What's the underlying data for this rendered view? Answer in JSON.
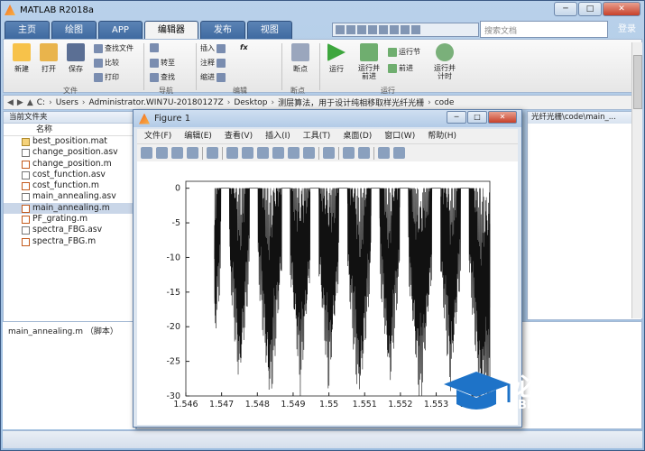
{
  "app": {
    "title": "MATLAB R2018a",
    "search_placeholder": "搜索文档",
    "login": "登录"
  },
  "tabs": [
    "主页",
    "绘图",
    "APP",
    "编辑器",
    "发布",
    "视图"
  ],
  "ribbon": {
    "new": "新建",
    "open": "打开",
    "save": "保存",
    "find_files": "查找文件",
    "compare": "比较",
    "print": "打印",
    "goto": "转至",
    "find": "查找",
    "insert": "插入",
    "comment": "注释",
    "indent": "缩进",
    "fx": "fx",
    "breakpoint": "断点",
    "run": "运行",
    "run_advance": "运行并\n前进",
    "run_section": "运行节",
    "advance": "前进",
    "run_time": "运行并\n计时",
    "groups": {
      "file": "文件",
      "navigate": "导航",
      "edit": "编辑",
      "breakpoints": "断点",
      "run": "运行"
    }
  },
  "path": [
    "C:",
    "Users",
    "Administrator.WIN7U-20180127Z",
    "Desktop",
    "测层算法，用于设计纯相移取样光纤光栅",
    "code"
  ],
  "left_panel": {
    "header": "当前文件夹",
    "column": "名称",
    "files": [
      {
        "name": "best_position.mat",
        "type": "mat"
      },
      {
        "name": "change_position.asv",
        "type": "asv"
      },
      {
        "name": "change_position.m",
        "type": "m"
      },
      {
        "name": "cost_function.asv",
        "type": "asv"
      },
      {
        "name": "cost_function.m",
        "type": "m"
      },
      {
        "name": "main_annealing.asv",
        "type": "asv"
      },
      {
        "name": "main_annealing.m",
        "type": "m"
      },
      {
        "name": "PF_grating.m",
        "type": "m"
      },
      {
        "name": "spectra_FBG.asv",
        "type": "asv"
      },
      {
        "name": "spectra_FBG.m",
        "type": "m"
      }
    ],
    "selected": "main_annealing.m",
    "detail": "main_annealing.m （脚本）"
  },
  "right_panel": {
    "path": "光纤光栅\\code\\main_..."
  },
  "figure": {
    "title": "Figure 1",
    "menu": [
      "文件(F)",
      "编辑(E)",
      "查看(V)",
      "插入(I)",
      "工具(T)",
      "桌面(D)",
      "窗口(W)",
      "帮助(H)"
    ]
  },
  "chart_data": {
    "type": "line",
    "title": "",
    "xlabel": "",
    "ylabel": "",
    "xlim": [
      1.546,
      1.5545
    ],
    "ylim": [
      -30,
      1
    ],
    "xticks": [
      1.546,
      1.547,
      1.548,
      1.549,
      1.55,
      1.551,
      1.552,
      1.553,
      1.554
    ],
    "yticks": [
      0,
      -5,
      -10,
      -15,
      -20,
      -25,
      -30
    ],
    "series": [
      {
        "name": "",
        "peaks_x": [
          1.5471,
          1.5479,
          1.5488,
          1.5496,
          1.5504,
          1.5513,
          1.5521,
          1.553,
          1.5538
        ],
        "peak_value": 0,
        "floor_value": -30,
        "mid_level": -14
      }
    ],
    "grid": false
  },
  "watermark": {
    "text": "必过源码",
    "sub": "Biguo100.com"
  },
  "colors": {
    "accent": "#3f6aa0",
    "plot_line": "#111111"
  }
}
